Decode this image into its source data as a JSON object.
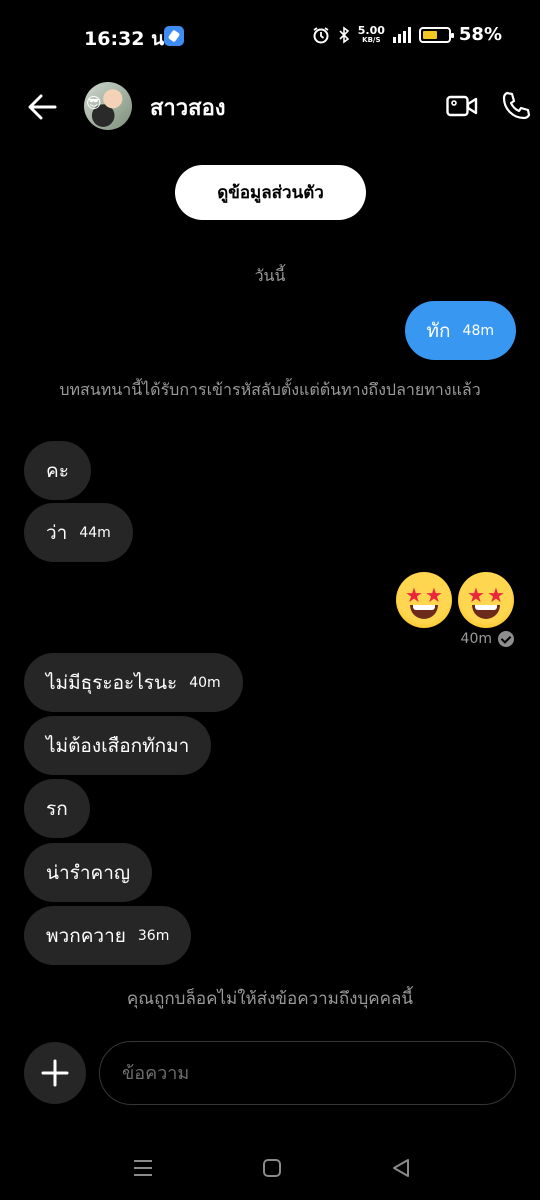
{
  "status_bar": {
    "time": "16:32 น.",
    "net_speed_value": "5.00",
    "net_speed_unit": "KB/S",
    "battery_percent": "58%",
    "battery_level": 0.58
  },
  "header": {
    "contact_name": "สาวสอง"
  },
  "profile_button_label": "ดูข้อมูลส่วนตัว",
  "day_label": "วันนี้",
  "messages": [
    {
      "dir": "out",
      "text": "ทัก",
      "time": "48m"
    },
    {
      "dir": "in",
      "text": "คะ",
      "time": ""
    },
    {
      "dir": "in",
      "text": "ว่า",
      "time": "44m"
    },
    {
      "dir": "in",
      "text": "ไม่มีธุระอะไรนะ",
      "time": "40m"
    },
    {
      "dir": "in",
      "text": "ไม่ต้องเสือกทักมา",
      "time": ""
    },
    {
      "dir": "in",
      "text": "รก",
      "time": ""
    },
    {
      "dir": "in",
      "text": "น่ารำคาญ",
      "time": ""
    },
    {
      "dir": "in",
      "text": "พวกควาย",
      "time": "36m"
    }
  ],
  "encryption_note": "บทสนทนานี้ได้รับการเข้ารหัสลับตั้งแต่ต้นทางถึงปลายทางแล้ว",
  "emoji_message": {
    "emoji": "star-struck-face",
    "count": 2,
    "time": "40m"
  },
  "blocked_note": "คุณถูกบล็อคไม่ให้ส่งข้อความถึงบุคคลนี้",
  "composer": {
    "placeholder": "ข้อความ"
  },
  "colors": {
    "outgoing_bubble": "#3897f0",
    "incoming_bubble": "#262626",
    "background": "#000000"
  }
}
